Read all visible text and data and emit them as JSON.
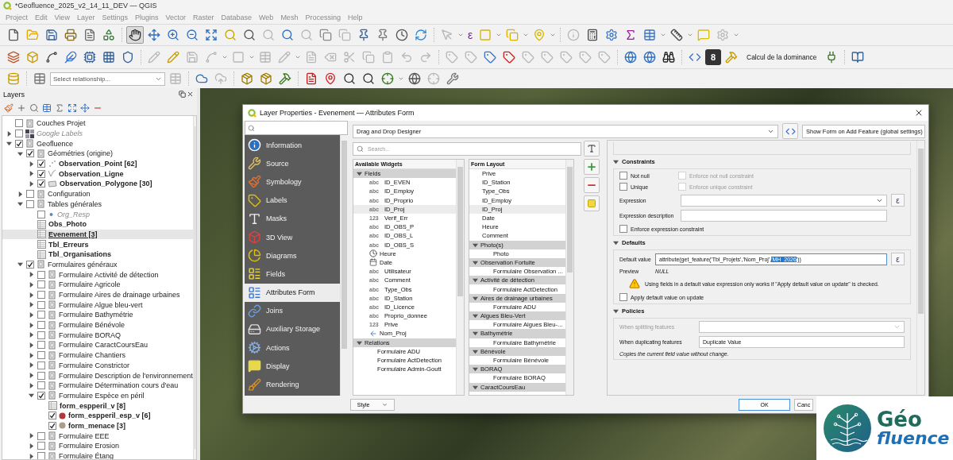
{
  "window": {
    "title": "*Geofluence_2025_v2_14_11_DEV — QGIS"
  },
  "menu": [
    "Project",
    "Edit",
    "View",
    "Layer",
    "Settings",
    "Plugins",
    "Vector",
    "Raster",
    "Database",
    "Web",
    "Mesh",
    "Processing",
    "Help"
  ],
  "toolbar": {
    "expression_symbol": "ε",
    "badge": "8",
    "dominance": "Calcul de la dominance",
    "relationship_placeholder": "Select relationship..."
  },
  "layers_panel": {
    "title": "Layers",
    "tree": [
      {
        "label": "Couches Projet",
        "kind": "group",
        "checked": false,
        "selected": false
      },
      {
        "label": "Google Labels",
        "kind": "raster",
        "checked": false,
        "expanded": false,
        "selected": false
      },
      {
        "label": "Geofluence",
        "kind": "group",
        "checked": true,
        "expanded": true,
        "selected": false,
        "children": [
          {
            "label": "Géométries (origine)",
            "kind": "group",
            "checked": true,
            "expanded": true,
            "selected": false,
            "children": [
              {
                "label": "Observation_Point [62]",
                "kind": "point",
                "checked": true,
                "expanded": false,
                "selected": false
              },
              {
                "label": "Observation_Ligne",
                "kind": "line",
                "checked": true,
                "expanded": false,
                "selected": false
              },
              {
                "label": "Observation_Polygone [30]",
                "kind": "polygon",
                "checked": true,
                "expanded": false,
                "selected": false
              }
            ]
          },
          {
            "label": "Configuration",
            "kind": "group",
            "checked": false,
            "expanded": false,
            "selected": false
          },
          {
            "label": "Tables générales",
            "kind": "group",
            "checked": false,
            "expanded": true,
            "selected": false,
            "children": [
              {
                "label": "Org_Resp",
                "kind": "unavailable",
                "checked": false,
                "selected": false
              },
              {
                "label": "Obs_Photo",
                "kind": "table",
                "selected": false
              },
              {
                "label": "Evenement [3]",
                "kind": "table",
                "selected": true
              },
              {
                "label": "Tbl_Erreurs",
                "kind": "table",
                "selected": false
              },
              {
                "label": "Tbl_Organisations",
                "kind": "table",
                "selected": false
              }
            ]
          },
          {
            "label": "Formulaires généraux",
            "kind": "group",
            "checked": true,
            "expanded": true,
            "selected": false,
            "children": [
              {
                "label": "Formulaire Activité de détection",
                "kind": "group",
                "checked": false,
                "expanded": false,
                "selected": false
              },
              {
                "label": "Formulaire Agricole",
                "kind": "group",
                "checked": false,
                "expanded": false,
                "selected": false
              },
              {
                "label": "Formulaire Aires de drainage urbaines",
                "kind": "group",
                "checked": false,
                "expanded": false,
                "selected": false
              },
              {
                "label": "Formulaire Algue bleu-vert",
                "kind": "group",
                "checked": false,
                "expanded": false,
                "selected": false
              },
              {
                "label": "Formulaire Bathymétrie",
                "kind": "group",
                "checked": false,
                "expanded": false,
                "selected": false
              },
              {
                "label": "Formulaire Bénévole",
                "kind": "group",
                "checked": false,
                "expanded": false,
                "selected": false
              },
              {
                "label": "Formulaire BORAQ",
                "kind": "group",
                "checked": false,
                "expanded": false,
                "selected": false
              },
              {
                "label": "Formulaire CaractCoursEau",
                "kind": "group",
                "checked": false,
                "expanded": false,
                "selected": false
              },
              {
                "label": "Formulaire Chantiers",
                "kind": "group",
                "checked": false,
                "expanded": false,
                "selected": false
              },
              {
                "label": "Formulaire Constrictor",
                "kind": "group",
                "checked": false,
                "expanded": false,
                "selected": false
              },
              {
                "label": "Formulaire Description de l'environnement",
                "kind": "group",
                "checked": false,
                "expanded": false,
                "selected": false
              },
              {
                "label": "Formulaire Détermination cours d'eau",
                "kind": "group",
                "checked": false,
                "expanded": false,
                "selected": false
              },
              {
                "label": "Formulaire Espèce en péril",
                "kind": "group",
                "checked": true,
                "expanded": true,
                "selected": false,
                "children": [
                  {
                    "label": "form_espperil_v [8]",
                    "kind": "table",
                    "selected": false
                  },
                  {
                    "label": "form_espperil_esp_v [6]",
                    "kind": "point",
                    "checked": true,
                    "color": "#b03a3a",
                    "selected": false
                  },
                  {
                    "label": "form_menace [3]",
                    "kind": "point",
                    "checked": true,
                    "color": "#ab9e86",
                    "selected": false
                  }
                ]
              },
              {
                "label": "Formulaire EEE",
                "kind": "group",
                "checked": false,
                "expanded": false,
                "selected": false
              },
              {
                "label": "Formulaire Erosion",
                "kind": "group",
                "checked": false,
                "expanded": false,
                "selected": false
              },
              {
                "label": "Formulaire Étang",
                "kind": "group",
                "checked": false,
                "expanded": false,
                "selected": false
              }
            ]
          }
        ]
      }
    ]
  },
  "dialog": {
    "title": "Layer Properties - Evenement — Attributes Form",
    "sidebar": [
      {
        "label": "Information",
        "selected": false
      },
      {
        "label": "Source",
        "selected": false
      },
      {
        "label": "Symbology",
        "selected": false
      },
      {
        "label": "Labels",
        "selected": false
      },
      {
        "label": "Masks",
        "selected": false
      },
      {
        "label": "3D View",
        "selected": false
      },
      {
        "label": "Diagrams",
        "selected": false
      },
      {
        "label": "Fields",
        "selected": false
      },
      {
        "label": "Attributes Form",
        "selected": true
      },
      {
        "label": "Joins",
        "selected": false
      },
      {
        "label": "Auxiliary Storage",
        "selected": false
      },
      {
        "label": "Actions",
        "selected": false
      },
      {
        "label": "Display",
        "selected": false
      },
      {
        "label": "Rendering",
        "selected": false
      }
    ],
    "layout_mode": "Drag and Drop Designer",
    "show_form": "Show Form on Add Feature (global settings)",
    "search_placeholder": "Search...",
    "available_widgets": {
      "title": "Available Widgets",
      "groups": [
        {
          "label": "Fields",
          "expanded": true,
          "children": [
            {
              "label": "ID_EVEN",
              "kind": "tag",
              "tag": "abc",
              "selected": false
            },
            {
              "label": "ID_Employ",
              "kind": "tag",
              "tag": "abc",
              "selected": false
            },
            {
              "label": "ID_Proprio",
              "kind": "tag",
              "tag": "abc",
              "selected": false
            },
            {
              "label": "ID_Proj",
              "kind": "tag",
              "tag": "abc",
              "selected": true
            },
            {
              "label": "Verif_Err",
              "kind": "tag",
              "tag": "123",
              "selected": false
            },
            {
              "label": "ID_OBS_P",
              "kind": "tag",
              "tag": "abc",
              "selected": false
            },
            {
              "label": "ID_OBS_L",
              "kind": "tag",
              "tag": "abc",
              "selected": false
            },
            {
              "label": "ID_OBS_S",
              "kind": "tag",
              "tag": "abc",
              "selected": false
            },
            {
              "label": "Heure",
              "kind": "time",
              "selected": false
            },
            {
              "label": "Date",
              "kind": "date",
              "selected": false
            },
            {
              "label": "Utilisateur",
              "kind": "tag",
              "tag": "abc",
              "selected": false
            },
            {
              "label": "Comment",
              "kind": "tag",
              "tag": "abc",
              "selected": false
            },
            {
              "label": "Type_Obs",
              "kind": "tag",
              "tag": "abc",
              "selected": false
            },
            {
              "label": "ID_Station",
              "kind": "tag",
              "tag": "abc",
              "selected": false
            },
            {
              "label": "ID_Licence",
              "kind": "tag",
              "tag": "abc",
              "selected": false
            },
            {
              "label": "Proprio_donnee",
              "kind": "tag",
              "tag": "abc",
              "selected": false
            },
            {
              "label": "Prive",
              "kind": "tag",
              "tag": "123",
              "selected": false
            },
            {
              "label": "Nom_Proj",
              "kind": "relation",
              "selected": false
            }
          ]
        },
        {
          "label": "Relations",
          "expanded": true,
          "children": [
            {
              "label": "Formulaire ADU",
              "kind": "plain",
              "selected": false
            },
            {
              "label": "Formulaire ActDetection",
              "kind": "plain",
              "selected": false
            },
            {
              "label": "Formulaire Admin-Goutt",
              "kind": "plain",
              "selected": false
            }
          ]
        }
      ]
    },
    "form_layout": {
      "title": "Form Layout",
      "items": [
        {
          "label": "Prive",
          "kind": "field",
          "selected": false
        },
        {
          "label": "ID_Station",
          "kind": "field",
          "selected": false
        },
        {
          "label": "Type_Obs",
          "kind": "field",
          "selected": false
        },
        {
          "label": "ID_Employ",
          "kind": "field",
          "selected": false
        },
        {
          "label": "ID_Proj",
          "kind": "field",
          "selected": true
        },
        {
          "label": "Date",
          "kind": "field",
          "selected": false
        },
        {
          "label": "Heure",
          "kind": "field",
          "selected": false
        },
        {
          "label": "Comment",
          "kind": "field",
          "selected": false
        },
        {
          "label": "Photo(s)",
          "kind": "container",
          "expanded": true,
          "selected": false,
          "children": [
            {
              "label": "Photo",
              "selected": false
            }
          ]
        },
        {
          "label": "Observation Fortuite",
          "kind": "container",
          "expanded": true,
          "selected": false,
          "children": [
            {
              "label": "Formulaire Observation ...",
              "selected": false
            }
          ]
        },
        {
          "label": "Activité de détection",
          "kind": "container",
          "expanded": true,
          "selected": false,
          "children": [
            {
              "label": "Formulaire ActDetection",
              "selected": false
            }
          ]
        },
        {
          "label": "Aires de drainage urbaines",
          "kind": "container",
          "expanded": true,
          "selected": false,
          "children": [
            {
              "label": "Formulaire ADU",
              "selected": false
            }
          ]
        },
        {
          "label": "Algues Bleu-Vert",
          "kind": "container",
          "expanded": true,
          "selected": false,
          "children": [
            {
              "label": "Formulaire Algues Bleu-...",
              "selected": false
            }
          ]
        },
        {
          "label": "Bathymétrie",
          "kind": "container",
          "expanded": true,
          "selected": false,
          "children": [
            {
              "label": "Formulaire Bathymétrie",
              "selected": false
            }
          ]
        },
        {
          "label": "Bénévole",
          "kind": "container",
          "expanded": true,
          "selected": false,
          "children": [
            {
              "label": "Formulaire Bénévole",
              "selected": false
            }
          ]
        },
        {
          "label": "BORAQ",
          "kind": "container",
          "expanded": true,
          "selected": false,
          "children": [
            {
              "label": "Formulaire BORAQ",
              "selected": false
            }
          ]
        },
        {
          "label": "CaractCoursEau",
          "kind": "container",
          "expanded": true,
          "selected": false
        }
      ]
    },
    "constraints": {
      "title": "Constraints",
      "expanded": true,
      "options": [
        {
          "label": "Not null",
          "checked": false,
          "disabled": false
        },
        {
          "label": "Enforce not null constraint",
          "checked": false,
          "disabled": true
        },
        {
          "label": "Unique",
          "checked": false,
          "disabled": false
        },
        {
          "label": "Enforce unique constraint",
          "checked": false,
          "disabled": true
        }
      ],
      "expression_label": "Expression",
      "expression_button": "ε",
      "description_label": "Expression description",
      "enforce": {
        "label": "Enforce expression constraint",
        "checked": false
      }
    },
    "defaults": {
      "title": "Defaults",
      "expanded": true,
      "label": "Default value",
      "value_before": "attribute(get_feature('Tbl_Projets','Nom_Proj',",
      "value_selected": "'MH_2026",
      "value_after": "'))",
      "expression_button": "ε",
      "preview_label": "Preview",
      "preview": "NULL",
      "warning": "Using fields in a default value expression only works if \"Apply default value on update\" is checked.",
      "apply": {
        "label": "Apply default value on update",
        "checked": false
      }
    },
    "policies": {
      "title": "Policies",
      "expanded": true,
      "split_label": "When splitting features",
      "split_disabled": true,
      "duplicate_label": "When duplicating features",
      "duplicate_value": "Duplicate Value",
      "note": "Copies the current field value without change."
    },
    "buttons": {
      "style": "Style",
      "ok": "OK",
      "cancel": "Canc"
    }
  },
  "logo": {
    "top": "Géo",
    "bottom": "fluence"
  }
}
